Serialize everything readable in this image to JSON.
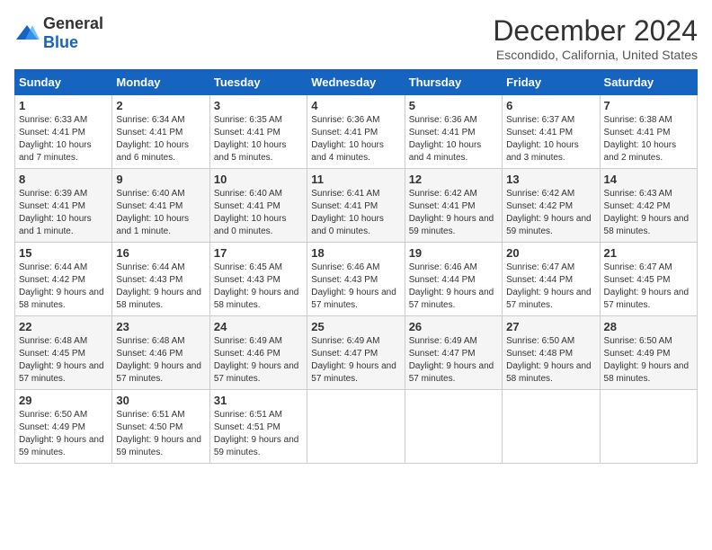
{
  "logo": {
    "general": "General",
    "blue": "Blue"
  },
  "title": "December 2024",
  "subtitle": "Escondido, California, United States",
  "days_of_week": [
    "Sunday",
    "Monday",
    "Tuesday",
    "Wednesday",
    "Thursday",
    "Friday",
    "Saturday"
  ],
  "weeks": [
    [
      {
        "day": "1",
        "sunrise": "6:33 AM",
        "sunset": "4:41 PM",
        "daylight": "10 hours and 7 minutes."
      },
      {
        "day": "2",
        "sunrise": "6:34 AM",
        "sunset": "4:41 PM",
        "daylight": "10 hours and 6 minutes."
      },
      {
        "day": "3",
        "sunrise": "6:35 AM",
        "sunset": "4:41 PM",
        "daylight": "10 hours and 5 minutes."
      },
      {
        "day": "4",
        "sunrise": "6:36 AM",
        "sunset": "4:41 PM",
        "daylight": "10 hours and 4 minutes."
      },
      {
        "day": "5",
        "sunrise": "6:36 AM",
        "sunset": "4:41 PM",
        "daylight": "10 hours and 4 minutes."
      },
      {
        "day": "6",
        "sunrise": "6:37 AM",
        "sunset": "4:41 PM",
        "daylight": "10 hours and 3 minutes."
      },
      {
        "day": "7",
        "sunrise": "6:38 AM",
        "sunset": "4:41 PM",
        "daylight": "10 hours and 2 minutes."
      }
    ],
    [
      {
        "day": "8",
        "sunrise": "6:39 AM",
        "sunset": "4:41 PM",
        "daylight": "10 hours and 1 minute."
      },
      {
        "day": "9",
        "sunrise": "6:40 AM",
        "sunset": "4:41 PM",
        "daylight": "10 hours and 1 minute."
      },
      {
        "day": "10",
        "sunrise": "6:40 AM",
        "sunset": "4:41 PM",
        "daylight": "10 hours and 0 minutes."
      },
      {
        "day": "11",
        "sunrise": "6:41 AM",
        "sunset": "4:41 PM",
        "daylight": "10 hours and 0 minutes."
      },
      {
        "day": "12",
        "sunrise": "6:42 AM",
        "sunset": "4:41 PM",
        "daylight": "9 hours and 59 minutes."
      },
      {
        "day": "13",
        "sunrise": "6:42 AM",
        "sunset": "4:42 PM",
        "daylight": "9 hours and 59 minutes."
      },
      {
        "day": "14",
        "sunrise": "6:43 AM",
        "sunset": "4:42 PM",
        "daylight": "9 hours and 58 minutes."
      }
    ],
    [
      {
        "day": "15",
        "sunrise": "6:44 AM",
        "sunset": "4:42 PM",
        "daylight": "9 hours and 58 minutes."
      },
      {
        "day": "16",
        "sunrise": "6:44 AM",
        "sunset": "4:43 PM",
        "daylight": "9 hours and 58 minutes."
      },
      {
        "day": "17",
        "sunrise": "6:45 AM",
        "sunset": "4:43 PM",
        "daylight": "9 hours and 58 minutes."
      },
      {
        "day": "18",
        "sunrise": "6:46 AM",
        "sunset": "4:43 PM",
        "daylight": "9 hours and 57 minutes."
      },
      {
        "day": "19",
        "sunrise": "6:46 AM",
        "sunset": "4:44 PM",
        "daylight": "9 hours and 57 minutes."
      },
      {
        "day": "20",
        "sunrise": "6:47 AM",
        "sunset": "4:44 PM",
        "daylight": "9 hours and 57 minutes."
      },
      {
        "day": "21",
        "sunrise": "6:47 AM",
        "sunset": "4:45 PM",
        "daylight": "9 hours and 57 minutes."
      }
    ],
    [
      {
        "day": "22",
        "sunrise": "6:48 AM",
        "sunset": "4:45 PM",
        "daylight": "9 hours and 57 minutes."
      },
      {
        "day": "23",
        "sunrise": "6:48 AM",
        "sunset": "4:46 PM",
        "daylight": "9 hours and 57 minutes."
      },
      {
        "day": "24",
        "sunrise": "6:49 AM",
        "sunset": "4:46 PM",
        "daylight": "9 hours and 57 minutes."
      },
      {
        "day": "25",
        "sunrise": "6:49 AM",
        "sunset": "4:47 PM",
        "daylight": "9 hours and 57 minutes."
      },
      {
        "day": "26",
        "sunrise": "6:49 AM",
        "sunset": "4:47 PM",
        "daylight": "9 hours and 57 minutes."
      },
      {
        "day": "27",
        "sunrise": "6:50 AM",
        "sunset": "4:48 PM",
        "daylight": "9 hours and 58 minutes."
      },
      {
        "day": "28",
        "sunrise": "6:50 AM",
        "sunset": "4:49 PM",
        "daylight": "9 hours and 58 minutes."
      }
    ],
    [
      {
        "day": "29",
        "sunrise": "6:50 AM",
        "sunset": "4:49 PM",
        "daylight": "9 hours and 59 minutes."
      },
      {
        "day": "30",
        "sunrise": "6:51 AM",
        "sunset": "4:50 PM",
        "daylight": "9 hours and 59 minutes."
      },
      {
        "day": "31",
        "sunrise": "6:51 AM",
        "sunset": "4:51 PM",
        "daylight": "9 hours and 59 minutes."
      },
      null,
      null,
      null,
      null
    ]
  ],
  "labels": {
    "sunrise": "Sunrise:",
    "sunset": "Sunset:",
    "daylight": "Daylight:"
  }
}
